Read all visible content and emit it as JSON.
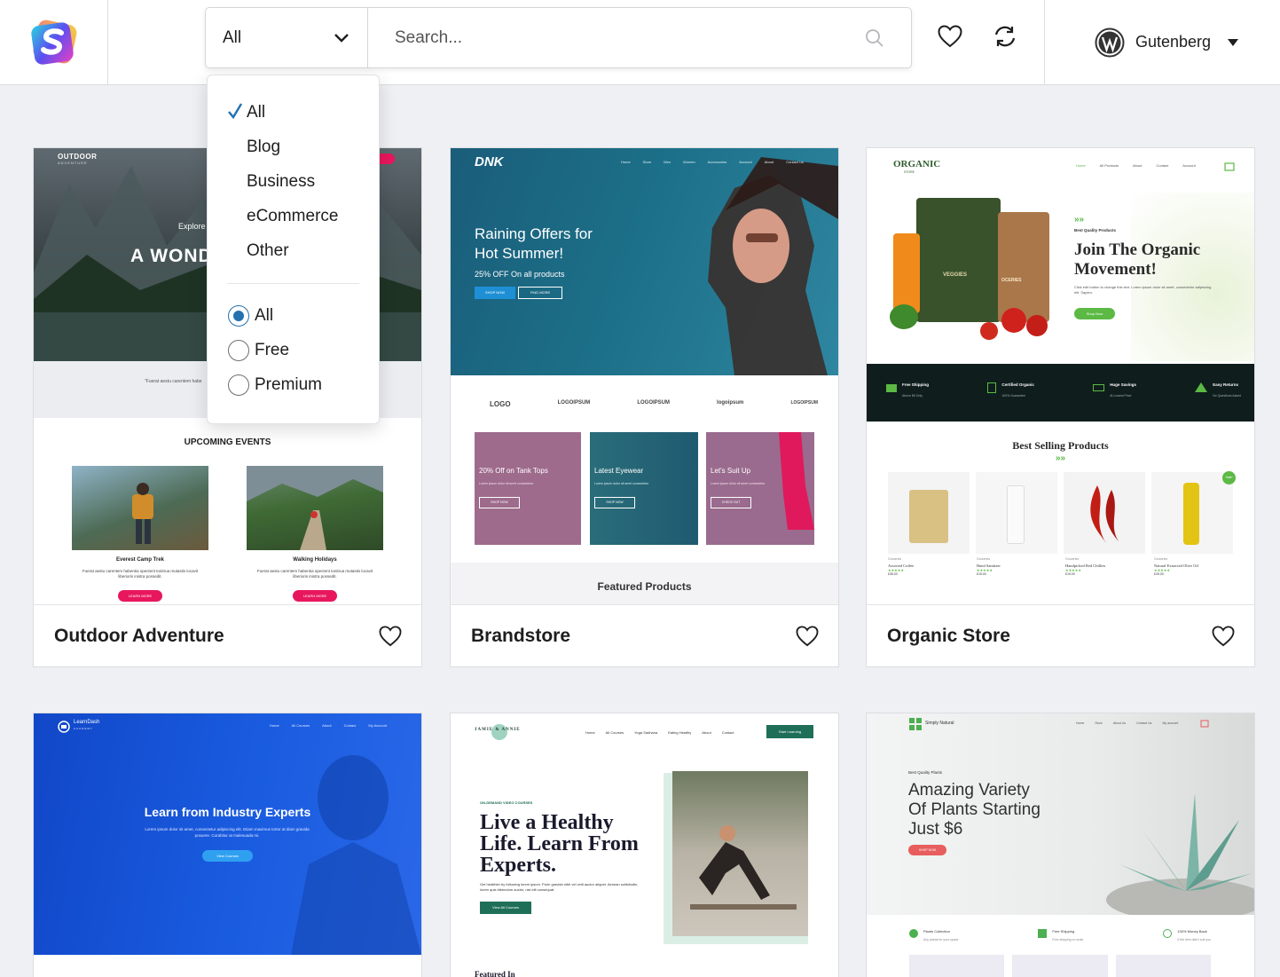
{
  "header": {
    "category_select": {
      "value": "All"
    },
    "search": {
      "placeholder": "Search..."
    },
    "builder": {
      "label": "Gutenberg"
    }
  },
  "dropdown": {
    "categories": [
      "All",
      "Blog",
      "Business",
      "eCommerce",
      "Other"
    ],
    "selected_category": "All",
    "pricing": [
      "All",
      "Free",
      "Premium"
    ],
    "selected_pricing": "All"
  },
  "cards": [
    {
      "title": "Outdoor Adventure",
      "preview": {
        "brand": "OUTDOOR",
        "brand_sub": "ADVENTURE",
        "hero_kicker": "Explore",
        "hero_title": "A WOND",
        "quote": "\"Fuerat aestu carentem habe",
        "events_heading": "UPCOMING EVENTS",
        "events": [
          {
            "title": "Everest Camp Trek",
            "text": "Fuerat aestu carentem habentia spectent tonitrua mutastis locavit liberioris inistra possedit.",
            "button": "LEARN MORE"
          },
          {
            "title": "Walking Holidays",
            "text": "Fuerat aestu carentem habentia spectent tonitrua mutastis locavit liberioris inistra possedit.",
            "button": "LEARN MORE"
          }
        ]
      }
    },
    {
      "title": "Brandstore",
      "preview": {
        "brand": "DNK",
        "nav": [
          "Home",
          "Store",
          "Men",
          "Women",
          "Accessories",
          "Account",
          "About",
          "Contact Us"
        ],
        "hero_title_1": "Raining Offers for",
        "hero_title_2": "Hot Summer!",
        "hero_sub": "25% OFF On all products",
        "btn_shop": "SHOP NOW",
        "btn_find": "FIND MORE",
        "logos": [
          "LOGO",
          "LOGOIPSUM",
          "LOGOIPSUM",
          "logoipsum",
          "LOGOIPSUM"
        ],
        "tiles": [
          {
            "title": "20% Off on Tank Tops",
            "text": "Lorem ipsum dolor sit amet consectetur",
            "button": "SHOP NOW"
          },
          {
            "title": "Latest Eyewear",
            "text": "Lorem ipsum dolor sit amet consectetur",
            "button": "SHOP NOW"
          },
          {
            "title": "Let's Suit Up",
            "text": "Lorem ipsum dolor sit amet consectetur",
            "button": "CHECK OUT"
          }
        ],
        "featured": "Featured Products"
      }
    },
    {
      "title": "Organic Store",
      "preview": {
        "brand": "ORGANIC",
        "brand_sub": "STORE",
        "nav": [
          "Home",
          "All Products",
          "About",
          "Contact",
          "Account"
        ],
        "kicker": "Best Quality Products",
        "hero_title_1": "Join The Organic",
        "hero_title_2": "Movement!",
        "hero_text": "Click edit button to change this text. Lorem ipsum dolor sit amet, consectetur adipiscing elit. Sapien.",
        "hero_btn": "Shop Now",
        "bag_label_1": "VEGGIES",
        "bag_label_2": "OCERIES",
        "features": [
          {
            "title": "Free Shipping",
            "text": "Above $5 Only"
          },
          {
            "title": "Certified Organic",
            "text": "100% Guarantee"
          },
          {
            "title": "Huge Savings",
            "text": "At Lowest Price"
          },
          {
            "title": "Easy Returns",
            "text": "No Questions Asked"
          }
        ],
        "best_heading": "Best Selling Products",
        "products": [
          {
            "cat": "Groceries",
            "name": "Assorted Coffee",
            "price": "£35.00"
          },
          {
            "cat": "Groceries",
            "name": "Hand Sanitizer",
            "price": "£15.00"
          },
          {
            "cat": "Groceries",
            "name": "Handpicked Red Chillies",
            "price": "£19.00"
          },
          {
            "cat": "Groceries",
            "name": "Natural Extracted Olive Oil",
            "price": "£25.00"
          }
        ],
        "sale_badge": "Sale!"
      }
    },
    {
      "title": "",
      "preview": {
        "brand": "LearnDash",
        "brand_sub": "ACADEMY",
        "nav": [
          "Home",
          "All Courses",
          "About",
          "Contact",
          "My Account"
        ],
        "hero_title": "Learn from Industry Experts",
        "hero_text": "Lorem ipsum dolor sit amet, consectetur adipiscing elit. Etiam maximus tortor at diam gravida posuere. Curabitur at malesuada mi.",
        "hero_btn": "View Courses"
      }
    },
    {
      "title": "",
      "preview": {
        "brand": "JAMIE & ANNIE",
        "nav": [
          "Home",
          "All Courses",
          "Yoga Sadhana",
          "Eating Healthy",
          "About",
          "Contact"
        ],
        "nav_btn": "Start Learning",
        "kicker": "ON-DEMAND VIDEO COURSES",
        "hero_title_1": "Live a Healthy",
        "hero_title_2": "Life. Learn From",
        "hero_title_3": "Experts.",
        "hero_text": "Get healthier by following lorem ipsum. Proin gravida nibh vel velit auctor aliquet. Aenean sollicitudin, lorem quis bibendum auctor, nisi elit consequat.",
        "hero_btn": "View All Courses",
        "featured": "Featured In"
      }
    },
    {
      "title": "",
      "preview": {
        "brand": "Simply Natural",
        "nav": [
          "Home",
          "Store",
          "About Us",
          "Contact Us",
          "My account"
        ],
        "kicker": "Best Quality Plants",
        "hero_title_1": "Amazing Variety",
        "hero_title_2": "Of Plants Starting",
        "hero_title_3": "Just $6",
        "hero_btn": "SHOP NOW",
        "features": [
          {
            "title": "Plants Collection",
            "text": "Any plants for your space"
          },
          {
            "title": "Free Shipping",
            "text": "Free shipping on order"
          },
          {
            "title": "100% Money Back",
            "text": "If the item didn't suit you"
          }
        ]
      }
    }
  ],
  "colors": {
    "accent_blue": "#2271b1",
    "brand_pink": "#e8175d",
    "organic_green": "#5bb944",
    "learndash_blue": "#1657d6",
    "jamie_green": "#1f6f58"
  }
}
